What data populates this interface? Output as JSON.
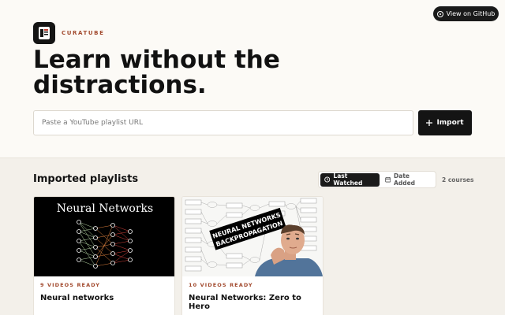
{
  "header": {
    "github_label": "View on GitHub",
    "brand": "CURATUBE",
    "hero_line1": "Learn without the",
    "hero_line2": "distractions."
  },
  "import": {
    "placeholder": "Paste a YouTube playlist URL",
    "value": "",
    "button_label": "Import"
  },
  "playlists": {
    "title": "Imported playlists",
    "sort": {
      "options": [
        "Last Watched",
        "Date Added"
      ],
      "selected": "Last Watched"
    },
    "count": "2 courses",
    "items": [
      {
        "status": "9 VIDEOS READY",
        "title": "Neural networks",
        "thumb_text": "Neural Networks"
      },
      {
        "status": "10 VIDEOS READY",
        "title": "Neural Networks: Zero to Hero",
        "thumb_text_1": "NEURAL NETWORKS",
        "thumb_text_2": "BACKPROPAGATION"
      }
    ]
  },
  "colors": {
    "accent": "#a24a2e",
    "dark": "#141414",
    "page_bg": "#fcfaf6",
    "section_bg": "#f3f0ea"
  }
}
